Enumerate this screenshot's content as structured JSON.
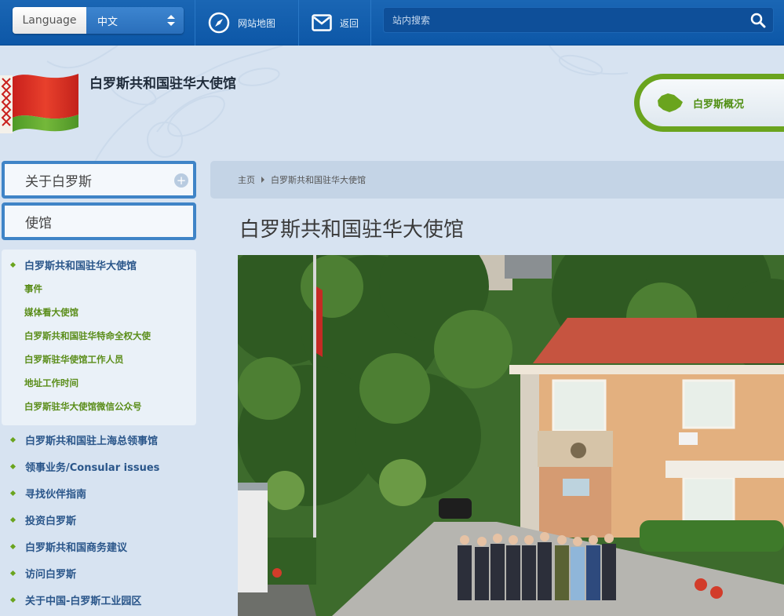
{
  "topbar": {
    "language_label": "Language",
    "language_value": "中文",
    "sitemap_label": "网站地图",
    "back_label": "返回",
    "search_placeholder": "站内搜索"
  },
  "header": {
    "site_title": "白罗斯共和国驻华大使馆",
    "overview_button": "白罗斯概况"
  },
  "sidebar": {
    "about": "关于白罗斯",
    "embassy": "使馆",
    "submenu_active": "白罗斯共和国驻华大使馆",
    "submenu_items": [
      "事件",
      "媒体看大使馆",
      "白罗斯共和国驻华特命全权大使",
      "白罗斯驻华使馆工作人员",
      "地址工作时间",
      "白罗斯驻华大使馆微信公众号"
    ],
    "main_items": [
      "白罗斯共和国驻上海总领事馆",
      "领事业务/Consular issues",
      "寻找伙伴指南",
      "投资白罗斯",
      "白罗斯共和国商务建议",
      "访问白罗斯",
      "关于中国-白罗斯工业园区"
    ]
  },
  "breadcrumb": {
    "home": "主页",
    "current": "白罗斯共和国驻华大使馆"
  },
  "main": {
    "title": "白罗斯共和国驻华大使馆"
  },
  "colors": {
    "topbar": "#0d57a7",
    "accent_green": "#6aa41e",
    "menu_border": "#3f84c7",
    "background": "#d7e3f1"
  },
  "icons": {
    "sitemap": "compass-icon",
    "back": "envelope-icon",
    "search": "search-icon"
  }
}
